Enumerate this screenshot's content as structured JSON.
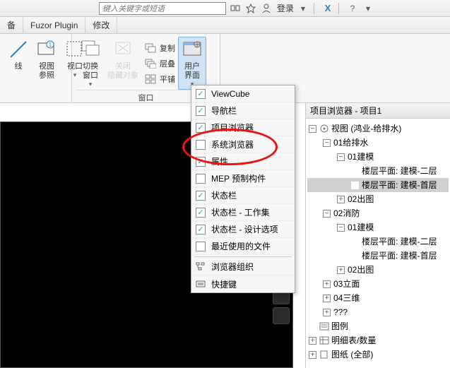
{
  "search": {
    "placeholder": "键入关键字或短语"
  },
  "topbar": {
    "login": "登录"
  },
  "menubar": {
    "item1": "备",
    "item2": "Fuzor Plugin",
    "item3": "修改"
  },
  "ribbon": {
    "panel1": {
      "btn1a": "线",
      "btn2a": "视图",
      "btn2b": "参照",
      "btn3a": "视口"
    },
    "panel2": {
      "btn1a": "切换",
      "btn1b": "窗口",
      "btn2a": "关闭",
      "btn2b": "隐藏对象",
      "s1": "复制",
      "s2": "层叠",
      "s3": "平铺",
      "btn3a": "用户",
      "btn3b": "界面",
      "title": "窗口"
    }
  },
  "dropdown": {
    "i1": "ViewCube",
    "i2": "导航栏",
    "i3": "项目浏览器",
    "i4": "系统浏览器",
    "i5": "属性",
    "i6": "MEP 预制构件",
    "i7": "状态栏",
    "i8": "状态栏 - 工作集",
    "i9": "状态栏 - 设计选项",
    "i10": "最近使用的文件",
    "i11": "浏览器组织",
    "i12": "快捷键"
  },
  "browser": {
    "title": "项目浏览器 - 项目1",
    "n1": "视图 (鸿业-给排水)",
    "n2": "01给排水",
    "n3": "01建模",
    "n4": "楼层平面: 建模-二层",
    "n5": "楼层平面: 建模-首层",
    "n6": "02出图",
    "n7": "02消防",
    "n8": "01建模",
    "n9": "楼层平面: 建模-二层",
    "n10": "楼层平面: 建模-首层",
    "n11": "02出图",
    "n12": "03立面",
    "n13": "04三维",
    "n14": "???",
    "n15": "图例",
    "n16": "明细表/数量",
    "n17": "图纸 (全部)"
  }
}
